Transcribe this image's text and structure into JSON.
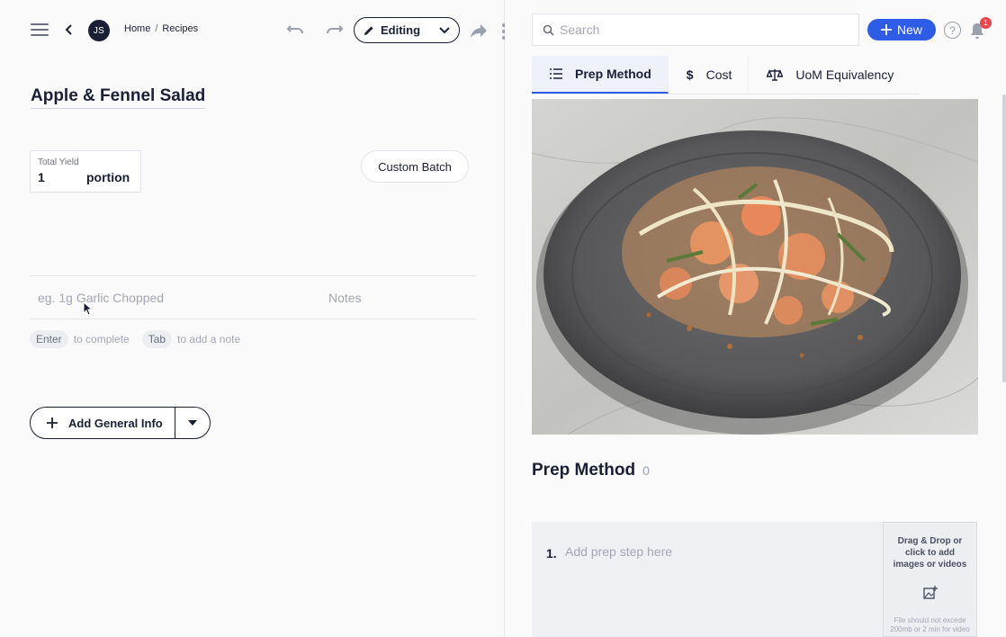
{
  "header": {
    "avatar_initials": "JS",
    "breadcrumb": {
      "home": "Home",
      "separator": "/",
      "current": "Recipes"
    },
    "mode_label": "Editing"
  },
  "recipe": {
    "title": "Apple & Fennel Salad",
    "yield": {
      "label": "Total Yield",
      "value": "1",
      "unit": "portion"
    },
    "custom_batch_label": "Custom Batch",
    "ingredient_placeholder": "eg. 1g Garlic Chopped",
    "notes_placeholder": "Notes",
    "hints": [
      {
        "key": "Enter",
        "text": "to complete"
      },
      {
        "key": "Tab",
        "text": "to add a note"
      }
    ],
    "general_info_label": "Add General Info"
  },
  "topbar_right": {
    "search_placeholder": "Search",
    "new_label": "New",
    "help_label": "?",
    "notifications_count": "1"
  },
  "tabs": [
    {
      "label": "Prep Method",
      "icon": "list-icon",
      "active": true
    },
    {
      "label": "Cost",
      "icon": "dollar-icon",
      "active": false
    },
    {
      "label": "UoM Equivalency",
      "icon": "scale-icon",
      "active": false
    }
  ],
  "prep": {
    "title": "Prep Method",
    "count": "0",
    "step_number": "1.",
    "step_placeholder": "Add prep step here",
    "dropzone_text": "Drag & Drop or click to add images or videos",
    "dropzone_note": "File should not excede 200mb or 2 min for video"
  },
  "colors": {
    "accent": "#2e5ce6",
    "text": "#1a1f36",
    "badge": "#e5484d"
  }
}
